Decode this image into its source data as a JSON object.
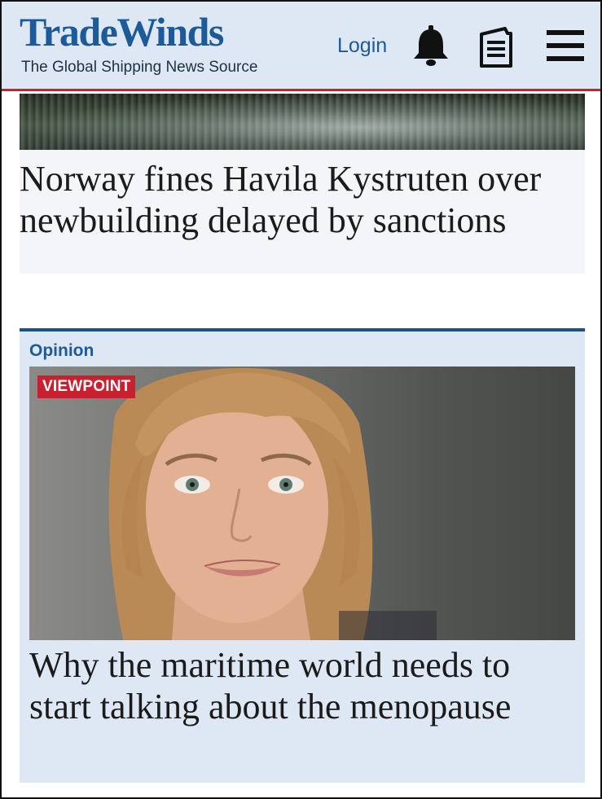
{
  "header": {
    "logo_title": "TradeWinds",
    "logo_tagline": "The Global Shipping News Source",
    "login_label": "Login",
    "icons": [
      "bell-icon",
      "newspaper-icon",
      "menu-icon"
    ],
    "accent_color": "#c8202f",
    "brand_color": "#1d5a9a"
  },
  "top_story": {
    "headline": "Norway fines Havila Kystruten over newbuilding delayed by sanctions"
  },
  "opinion": {
    "section_label": "Opinion",
    "badge": "VIEWPOINT",
    "headline": "Why the maritime world needs to start talking about the menopause"
  }
}
